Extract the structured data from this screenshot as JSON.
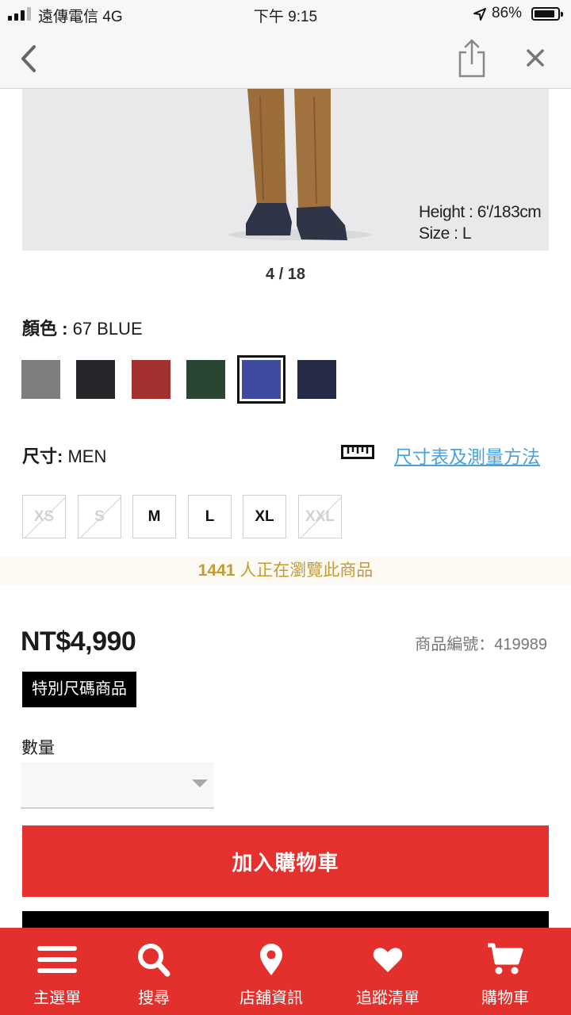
{
  "status_bar": {
    "carrier": "遠傳電信 4G",
    "time": "下午 9:15",
    "battery": "86%",
    "battery_level": 0.86
  },
  "product": {
    "image_pager": "4 / 18",
    "model_height": "Height : 6'/183cm",
    "model_size": "Size : L",
    "color_label": "顏色 :",
    "color_value": " 67 BLUE",
    "colors": [
      {
        "name": "gray",
        "hex": "#7f7e7e"
      },
      {
        "name": "black",
        "hex": "#26262b"
      },
      {
        "name": "red",
        "hex": "#a1302e"
      },
      {
        "name": "green",
        "hex": "#2a4531"
      },
      {
        "name": "blue",
        "hex": "#3f4aa1",
        "selected": true
      },
      {
        "name": "navy",
        "hex": "#252b47"
      }
    ],
    "size_label": "尺寸:",
    "size_value": " MEN",
    "size_chart_link": "尺寸表及測量方法",
    "sizes": [
      {
        "label": "XS",
        "available": false
      },
      {
        "label": "S",
        "available": false
      },
      {
        "label": "M",
        "available": true
      },
      {
        "label": "L",
        "available": true
      },
      {
        "label": "XL",
        "available": true
      },
      {
        "label": "XXL",
        "available": false
      }
    ],
    "viewers_count": "1441",
    "viewers_text": " 人正在瀏覽此商品",
    "price": "NT$4,990",
    "product_number": "商品編號：419989",
    "badge": "特別尺碼商品",
    "quantity_label": "數量",
    "quantity_value": "",
    "add_to_cart": "加入購物車"
  },
  "tab_bar": {
    "items": [
      {
        "label": "主選單",
        "icon": "menu-icon"
      },
      {
        "label": "搜尋",
        "icon": "search-icon"
      },
      {
        "label": "店舖資訊",
        "icon": "location-pin-icon"
      },
      {
        "label": "追蹤清單",
        "icon": "heart-icon"
      },
      {
        "label": "購物車",
        "icon": "cart-icon"
      }
    ]
  },
  "colors": {
    "accent_red": "#e4302d",
    "link_blue": "#4aa1dd",
    "viewers_gold": "#c49a33"
  }
}
